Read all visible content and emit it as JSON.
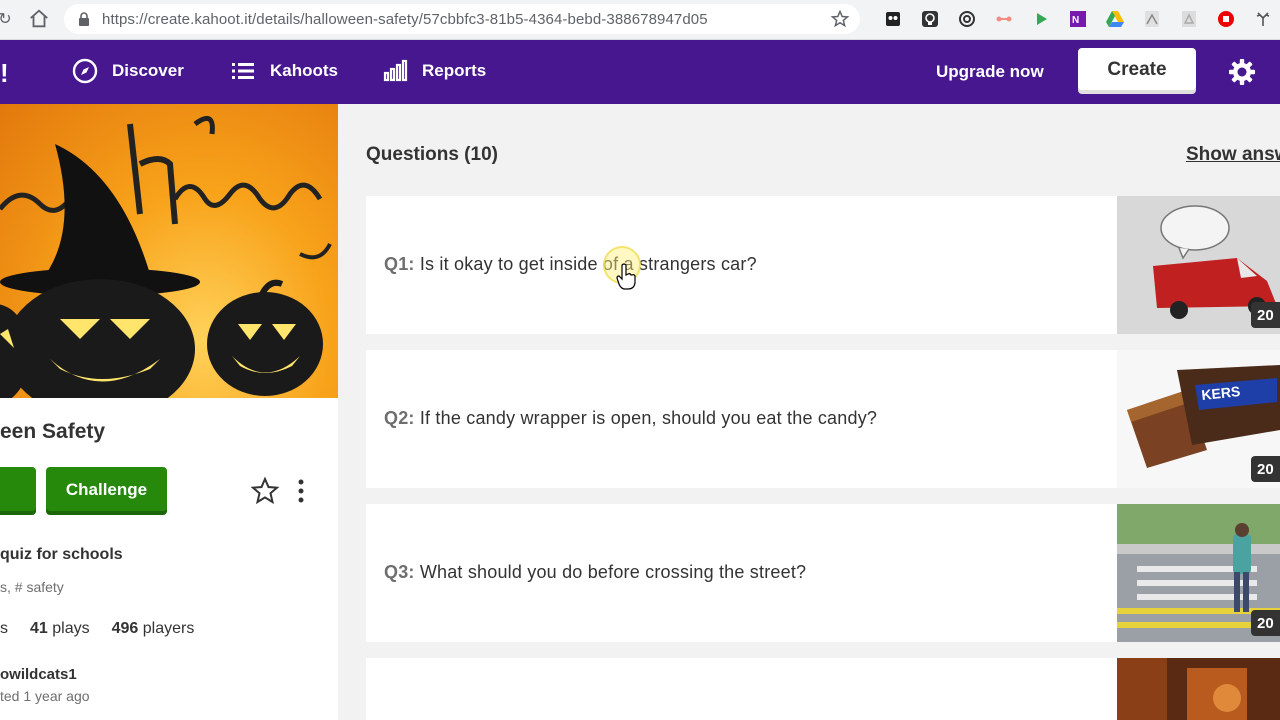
{
  "browser": {
    "url": "https://create.kahoot.it/details/halloween-safety/57cbbfc3-81b5-4364-bebd-388678947d05",
    "extensions": [
      "owl-icon",
      "bulb-icon",
      "spiral-icon",
      "share-icon",
      "play-icon",
      "onenote-icon",
      "drive-icon",
      "pdf-icon",
      "acrobat-icon",
      "stop-icon",
      "antler-icon"
    ]
  },
  "topnav": {
    "logo": "!",
    "discover": "Discover",
    "kahoots": "Kahoots",
    "reports": "Reports",
    "upgrade": "Upgrade now",
    "create": "Create"
  },
  "kahoot": {
    "title": "een Safety",
    "challenge": "Challenge",
    "description": "quiz for schools",
    "tags": "s, # safety",
    "stats": {
      "lead": "s",
      "plays_count": "41",
      "plays_label": "plays",
      "players_count": "496",
      "players_label": "players"
    },
    "author": "owildcats1",
    "updated": "ted 1 year ago"
  },
  "questions": {
    "header": "Questions (10)",
    "show_answers": "Show answers",
    "items": [
      {
        "num": "Q1:",
        "text": "Is it okay to get inside of a strangers car?",
        "time": "20"
      },
      {
        "num": "Q2:",
        "text": "If the candy wrapper is open, should you eat the candy?",
        "time": "20"
      },
      {
        "num": "Q3:",
        "text": "What should you do before crossing the street?",
        "time": "20"
      }
    ]
  },
  "colors": {
    "brand_purple": "#46178f",
    "green": "#26890c"
  }
}
